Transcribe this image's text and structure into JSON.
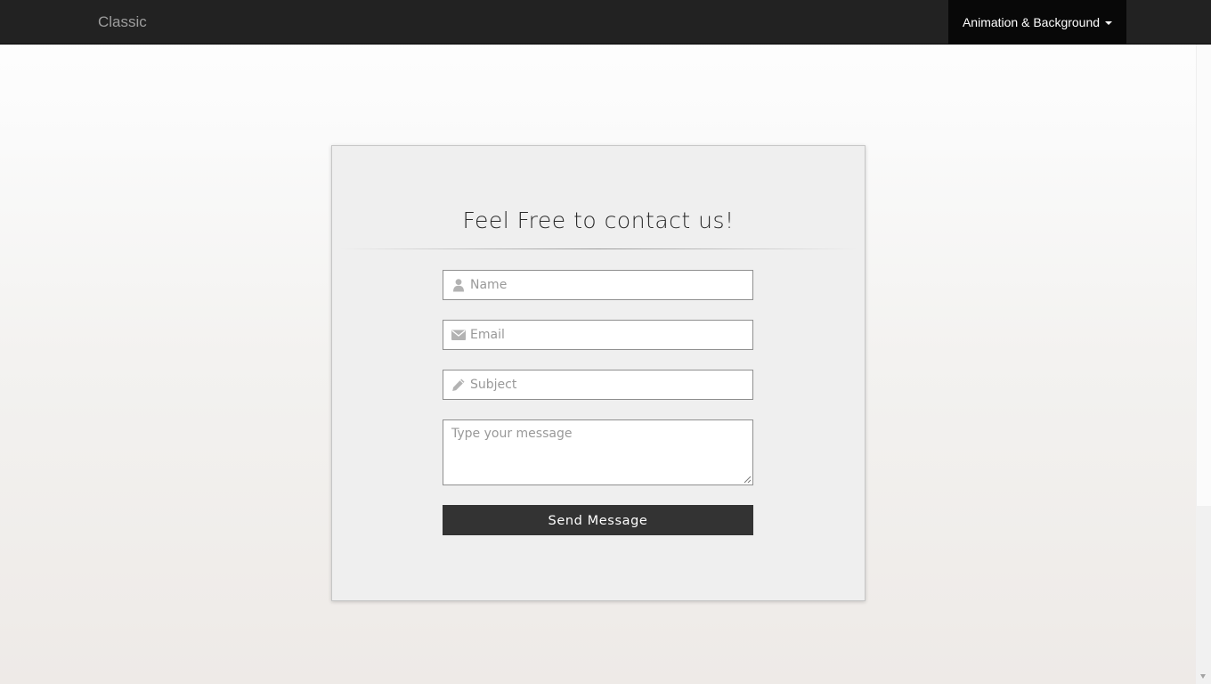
{
  "navbar": {
    "brand": "Classic",
    "dropdown_label": "Animation & Background"
  },
  "contact": {
    "title": "Feel Free to contact us!",
    "name_placeholder": "Name",
    "email_placeholder": "Email",
    "subject_placeholder": "Subject",
    "message_placeholder": "Type your message",
    "send_label": "Send Message"
  },
  "icons": {
    "name": "user-icon",
    "email": "envelope-icon",
    "subject": "pencil-icon",
    "dropdown": "caret-down-icon"
  },
  "colors": {
    "navbar_bg": "#222222",
    "navbar_active_bg": "#080808",
    "button_bg": "#333333",
    "card_bg": "#efefef"
  }
}
